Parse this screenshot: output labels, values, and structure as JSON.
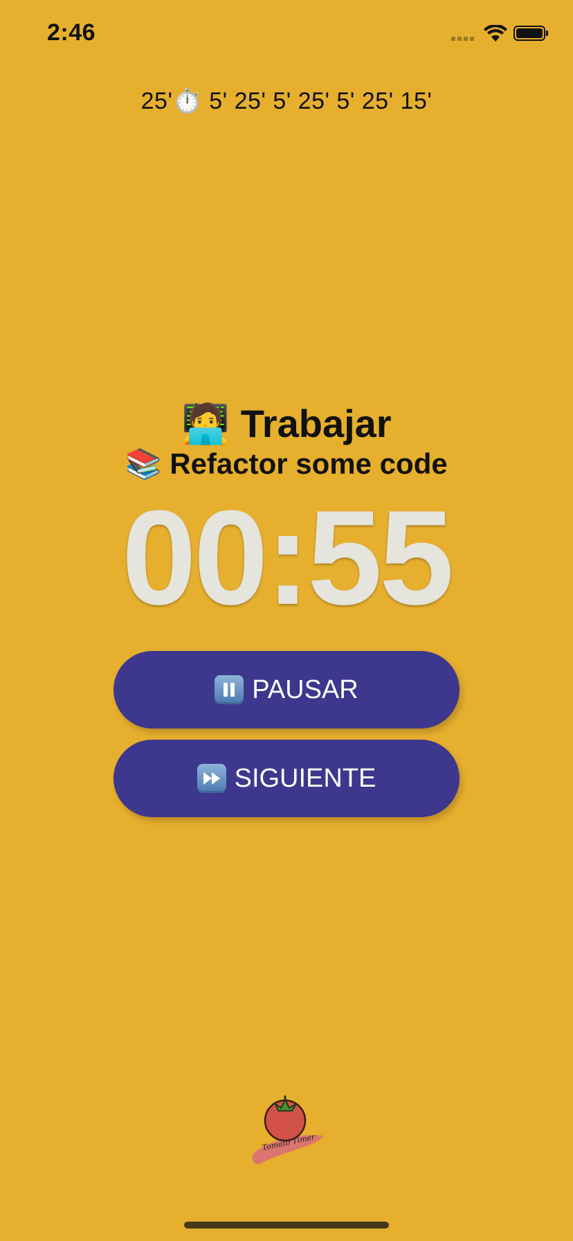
{
  "status_bar": {
    "time": "2:46"
  },
  "sequence": {
    "text": "25'⏱️ 5' 25' 5' 25' 5' 25' 15'"
  },
  "task": {
    "title": "🧑‍💻 Trabajar",
    "subtitle": "📚 Refactor some code"
  },
  "timer": {
    "value": "00:55"
  },
  "buttons": {
    "pause_label": "PAUSAR",
    "next_label": "SIGUIENTE"
  },
  "logo": {
    "text": "Tomato Timer"
  },
  "colors": {
    "background": "#E6AF2E",
    "button": "#3D378D",
    "timer_text": "#E5E4DD"
  }
}
